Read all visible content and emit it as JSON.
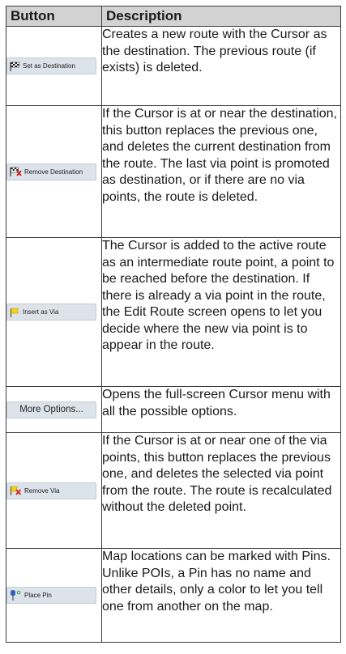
{
  "headers": {
    "button": "Button",
    "description": "Description"
  },
  "rows": [
    {
      "button_label": "Set as Destination",
      "icon": "checkered-flag-icon",
      "description": "Creates a new route with the Cursor as the destination. The previous route (if exists) is deleted."
    },
    {
      "button_label": "Remove Destination",
      "icon": "remove-flag-icon",
      "description": "If the Cursor is at or near the destination, this button replaces the previous one, and deletes the current destination from the route. The last via point is promoted as destination, or if there are no via points, the route is deleted."
    },
    {
      "button_label": "Insert as Via",
      "icon": "yellow-flag-icon",
      "description": "The Cursor is added to the active route as an intermediate route point, a point to be reached before the destination. If there is already a via point in the route, the Edit Route screen opens to let you decide where the new via point is to appear in the route."
    },
    {
      "button_label": "More Options...",
      "icon": "",
      "description": "Opens the full-screen Cursor menu with all the possible options."
    },
    {
      "button_label": "Remove Via",
      "icon": "remove-via-flag-icon",
      "description": "If the Cursor is at or near one of the via points, this button replaces the previous one, and deletes the selected via point from the route. The route is recalculated without the deleted point."
    },
    {
      "button_label": "Place Pin",
      "icon": "pin-icon",
      "description": "Map locations can be marked with Pins. Unlike POIs, a Pin has no name and other details, only a color to let you tell one from another on the map."
    }
  ]
}
